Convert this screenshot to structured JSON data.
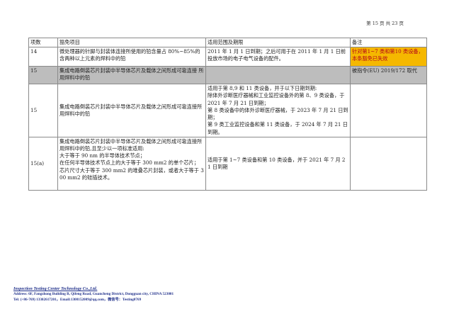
{
  "page": {
    "page_number": "第 15 页 共 23 页"
  },
  "table": {
    "headers": [
      "项数",
      "豁免项目",
      "适用范围及期限",
      "备注"
    ],
    "rows": [
      {
        "no": "14",
        "item": "微处理器的针脚与封装体连接所使用的铅含量占 80%~85%的含两种以上元素的焊料中的铅",
        "scope": "2011 年 1 月 1 日到期；之后可用于在 2011 年 1 月 1 日前投放市场的电子电气设备的配件。",
        "note": "针对第1~7 类和第10 类设备，本条豁免已失效"
      },
      {
        "no": "15",
        "item": "集成电路倒装芯片封装中半导体芯片及载体之间形成可靠连接 所用焊料中的铅",
        "scope": "",
        "note": "被指令(EU) 2019/172 取代"
      },
      {
        "no": "15",
        "item": "集成电路倒装芯片封装中半导体芯片及载体之间形成可靠连接所用焊料中的铅",
        "scope_lines": [
          "适用于第 8,9 和 11 类设备，并于以下日期到期:",
          "除体外诊断医疗器械和工业监控设备外的第 8、9 类设备，于 2021 年 7 月 21 日到期；",
          "第 8 类设备中的体外诊断医疗器械，于 2023 年 7 月 21 日到期；",
          "第 9 类工业监控设备和第 11 类设备，于 2024 年 7 月 21 日到期。"
        ],
        "note": ""
      },
      {
        "no": "15(a)",
        "item_lines": [
          "集成电路倒装芯片封装中半导体芯片及载体之间形成可靠连接所用焊料中的铅,且至少以一项标准适用:",
          "大于等于 90 nm 的半导体技术节点；",
          "在任何半导体技术节点上的大于等于 300 mm2 的单个芯片；芯片尺寸大于等于 300 mm2 的堆叠芯片封装，或者大于等于 300 mm2 的硅插技术。"
        ],
        "scope": "适用于第 1~7 类设备和第 10 类设备，并于 2021 年 7 月 21 日到期",
        "note": ""
      }
    ]
  },
  "footer": {
    "company": "Inspection Testing Center Technology Co.,Ltd.",
    "address": "Address: 6F, Fangzhong Building B, Qifeng Road, Guancheng District, Dongguan city, CHINA 523001",
    "contact": "Tel: (+86-769) 13302617201，Email:1308152009@qq.com，微信号：Testing0769"
  },
  "colors": {
    "highlight_background": "#f5b800",
    "highlight_text": "#b3001b",
    "shaded_row": "#bdbdbd",
    "footer_text": "#1f2f8a"
  }
}
